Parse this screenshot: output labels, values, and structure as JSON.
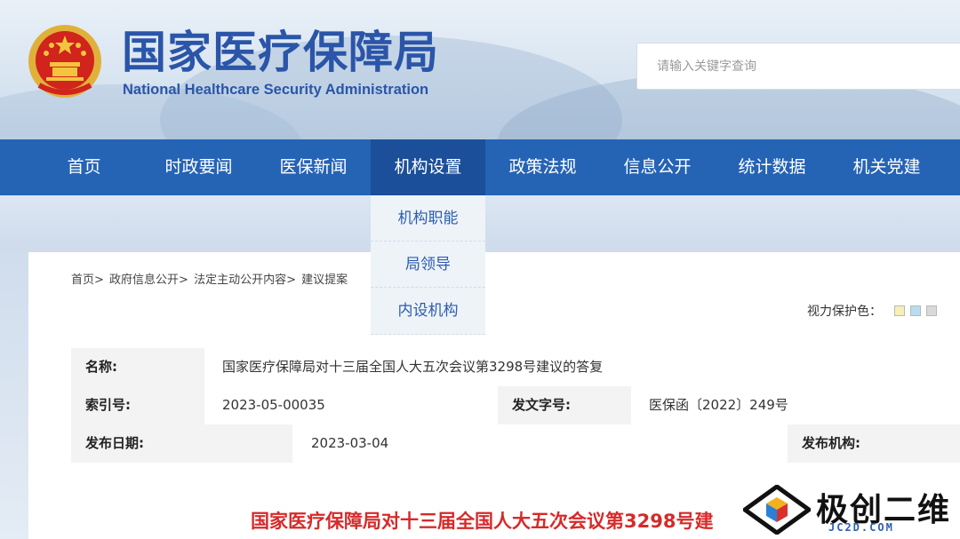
{
  "header": {
    "title": "国家医疗保障局",
    "subtitle": "National Healthcare Security Administration",
    "search_placeholder": "请输入关键字查询"
  },
  "nav": {
    "items": [
      "首页",
      "时政要闻",
      "医保新闻",
      "机构设置",
      "政策法规",
      "信息公开",
      "统计数据",
      "机关党建"
    ],
    "active_index": 3
  },
  "dropdown": {
    "items": [
      "机构职能",
      "局领导",
      "内设机构"
    ]
  },
  "breadcrumb": {
    "items": [
      "首页>",
      "政府信息公开>",
      "法定主动公开内容>",
      "建议提案"
    ]
  },
  "eye_care": {
    "label": "视力保护色：",
    "colors": [
      "#f7efb4",
      "#b9dcef",
      "#d9d9d9"
    ]
  },
  "meta": {
    "name_label": "名称:",
    "name_value": "国家医疗保障局对十三届全国人大五次会议第3298号建议的答复",
    "index_label": "索引号:",
    "index_value": "2023-05-00035",
    "docno_label": "发文字号:",
    "docno_value": "医保函〔2022〕249号",
    "date_label": "发布日期:",
    "date_value": "2023-03-04",
    "org_label": "发布机构:"
  },
  "doc_title": "国家医疗保障局对十三届全国人大五次会议第3298号建",
  "watermark": {
    "text": "极创二维",
    "sub": "JC2D.COM"
  },
  "colors": {
    "nav_bg": "#2563b5",
    "nav_active": "#1b4f99",
    "title_blue": "#2a55a8",
    "doc_title_red": "#d62a2a"
  }
}
